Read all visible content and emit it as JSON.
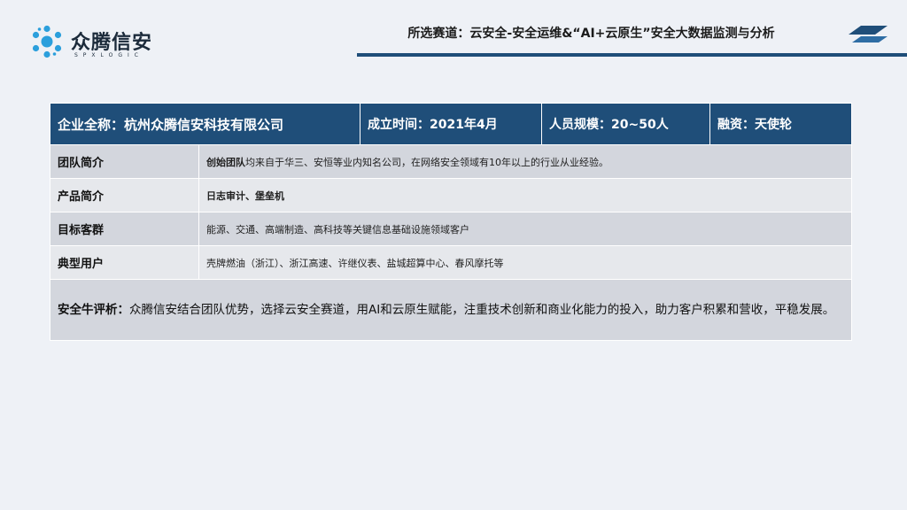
{
  "brand": {
    "name": "众腾信安",
    "subtitle": "SPXLOGIC",
    "logo_icon": "molecule-logo-icon"
  },
  "header": {
    "title": "所选赛道：云安全-安全运维&“AI+云原生”安全大数据监测与分析",
    "accent_color": "#1f4e79"
  },
  "company": {
    "full_name": "企业全称：杭州众腾信安科技有限公司",
    "founded": "成立时间：2021年4月",
    "staff_size": "人员规模：20~50人",
    "funding": "融资：天使轮"
  },
  "rows": [
    {
      "label": "团队简介",
      "value_bold": "创始团队",
      "value": "均来自于华三、安恒等业内知名公司，在网络安全领域有10年以上的行业从业经验。"
    },
    {
      "label": "产品简介",
      "value_bold": "日志审计、堡垒机",
      "value": ""
    },
    {
      "label": "目标客群",
      "value_bold": "",
      "value": "能源、交通、高端制造、高科技等关键信息基础设施领域客户"
    },
    {
      "label": "典型用户",
      "value_bold": "",
      "value": "壳牌燃油（浙江）、浙江高速、许继仪表、盐城超算中心、春风摩托等"
    }
  ],
  "evaluation": {
    "label": "安全牛评析：",
    "text": "众腾信安结合团队优势，选择云安全赛道，用AI和云原生赋能，注重技术创新和商业化能力的投入，助力客户积累和营收，平稳发展。"
  }
}
